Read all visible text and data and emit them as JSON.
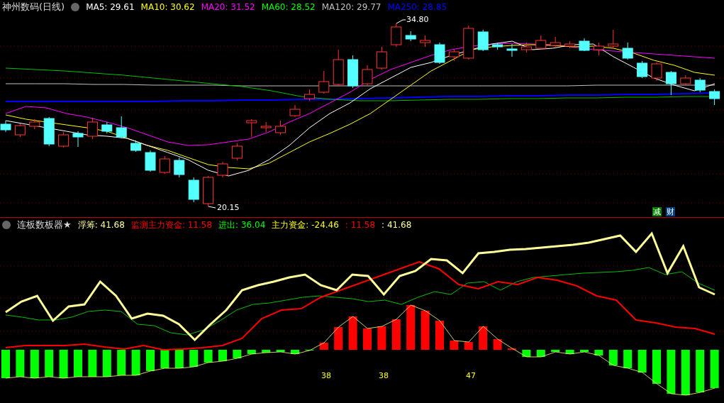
{
  "main_panel": {
    "title": "神州数码(日线)",
    "indicators": [
      {
        "text": "MA5: 29.61",
        "color": "#ffffff"
      },
      {
        "text": "MA10: 30.62",
        "color": "#ffff00"
      },
      {
        "text": "MA20: 31.52",
        "color": "#ff00ff"
      },
      {
        "text": "MA60: 28.52",
        "color": "#00ff00"
      },
      {
        "text": "MA120: 29.77",
        "color": "#c0c0c0"
      },
      {
        "text": "MA250: 28.85",
        "color": "#0000ff"
      }
    ],
    "high_label": "34.80",
    "low_label": "20.15",
    "badges": [
      {
        "text": "减",
        "color": "#007f00"
      },
      {
        "text": "财",
        "color": "#003f7f"
      }
    ]
  },
  "sub_panel": {
    "title": "连板数板器★",
    "indicators": [
      {
        "text": "浮筹: 41.68",
        "color": "#ffff99"
      },
      {
        "text": "监测主力资金: 11.58",
        "color": "#ff0000"
      },
      {
        "text": "进出: 36.04",
        "color": "#00ff00"
      },
      {
        "text": "主力资金: -24.46",
        "color": "#ffff00"
      },
      {
        "text": ": 11.58",
        "color": "#ff0000"
      },
      {
        "text": ": 41.68",
        "color": "#ffff99"
      }
    ],
    "bar_labels": [
      "38",
      "38",
      "47"
    ]
  }
}
